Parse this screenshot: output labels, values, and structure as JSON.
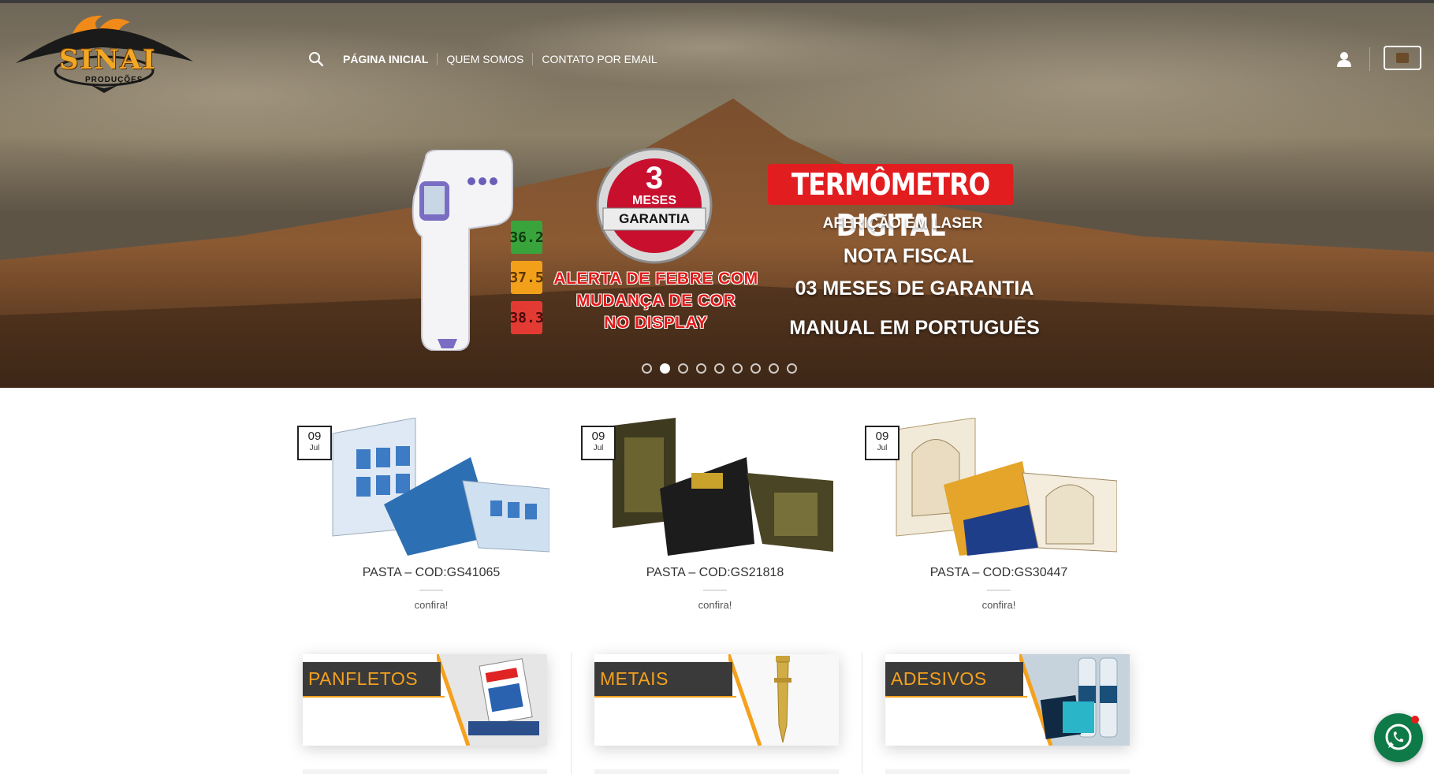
{
  "header": {
    "logo_text": "SINAI",
    "logo_subtext": "PRODUÇÕES",
    "nav": [
      {
        "label": "PÁGINA INICIAL",
        "active": true
      },
      {
        "label": "QUEM SOMOS",
        "active": false
      },
      {
        "label": "CONTATO POR EMAIL",
        "active": false
      }
    ],
    "icons": [
      "search-icon",
      "user-icon",
      "cart-icon"
    ]
  },
  "slider": {
    "indicators": [
      "36.2",
      "37.5",
      "38.3"
    ],
    "badge": {
      "number": "3",
      "line1": "MESES",
      "line2": "GARANTIA"
    },
    "alert": [
      "ALERTA DE FEBRE COM",
      "MUDANÇA DE COR",
      "NO DISPLAY"
    ],
    "title": "TERMÔMETRO DIGITAL",
    "features": [
      "AFERIÇÃO EM LASER",
      "NOTA FISCAL",
      "03 MESES DE GARANTIA",
      "MANUAL EM PORTUGUÊS"
    ],
    "slide_count": 9,
    "active_slide": 2
  },
  "products": [
    {
      "day": "09",
      "month": "Jul",
      "title": "PASTA – COD:GS41065",
      "link": "confira!"
    },
    {
      "day": "09",
      "month": "Jul",
      "title": "PASTA – COD:GS21818",
      "link": "confira!"
    },
    {
      "day": "09",
      "month": "Jul",
      "title": "PASTA – COD:GS30447",
      "link": "confira!"
    }
  ],
  "categories": [
    {
      "label": "PANFLETOS"
    },
    {
      "label": "METAIS"
    },
    {
      "label": "ADESIVOS"
    }
  ],
  "colors": {
    "accent": "#f4a11d",
    "category_band": "#3a3a3a",
    "slide_red": "#e21d20",
    "whatsapp": "#0e7a47"
  }
}
